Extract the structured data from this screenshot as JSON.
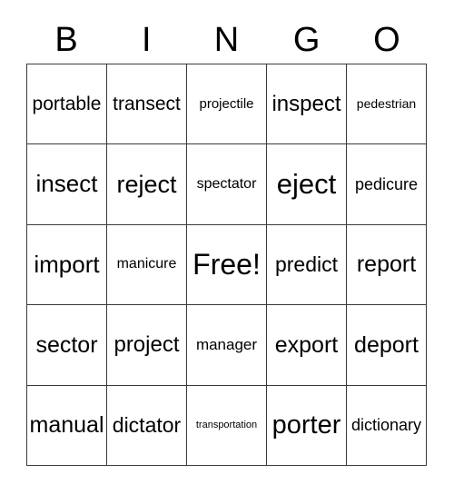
{
  "card": {
    "title_letters": [
      "B",
      "I",
      "N",
      "G",
      "O"
    ],
    "columns": 5,
    "rows": 5,
    "free_space_label": "Free!",
    "free_space_position": "center",
    "grid_line_color": "#3a3a3a",
    "background_color": "#ffffff",
    "text_color": "#000000",
    "cells": [
      [
        {
          "text": "portable",
          "font_size": 21
        },
        {
          "text": "transect",
          "font_size": 21
        },
        {
          "text": "projectile",
          "font_size": 15
        },
        {
          "text": "inspect",
          "font_size": 24
        },
        {
          "text": "pedestrian",
          "font_size": 14
        }
      ],
      [
        {
          "text": "insect",
          "font_size": 26
        },
        {
          "text": "reject",
          "font_size": 27
        },
        {
          "text": "spectator",
          "font_size": 16
        },
        {
          "text": "eject",
          "font_size": 31
        },
        {
          "text": "pedicure",
          "font_size": 18
        }
      ],
      [
        {
          "text": "import",
          "font_size": 26
        },
        {
          "text": "manicure",
          "font_size": 16
        },
        {
          "text": "Free!",
          "font_size": 32
        },
        {
          "text": "predict",
          "font_size": 23
        },
        {
          "text": "report",
          "font_size": 25
        }
      ],
      [
        {
          "text": "sector",
          "font_size": 25
        },
        {
          "text": "project",
          "font_size": 24
        },
        {
          "text": "manager",
          "font_size": 17
        },
        {
          "text": "export",
          "font_size": 25
        },
        {
          "text": "deport",
          "font_size": 25
        }
      ],
      [
        {
          "text": "manual",
          "font_size": 25
        },
        {
          "text": "dictator",
          "font_size": 23
        },
        {
          "text": "transportation",
          "font_size": 11
        },
        {
          "text": "porter",
          "font_size": 29
        },
        {
          "text": "dictionary",
          "font_size": 18
        }
      ]
    ]
  }
}
